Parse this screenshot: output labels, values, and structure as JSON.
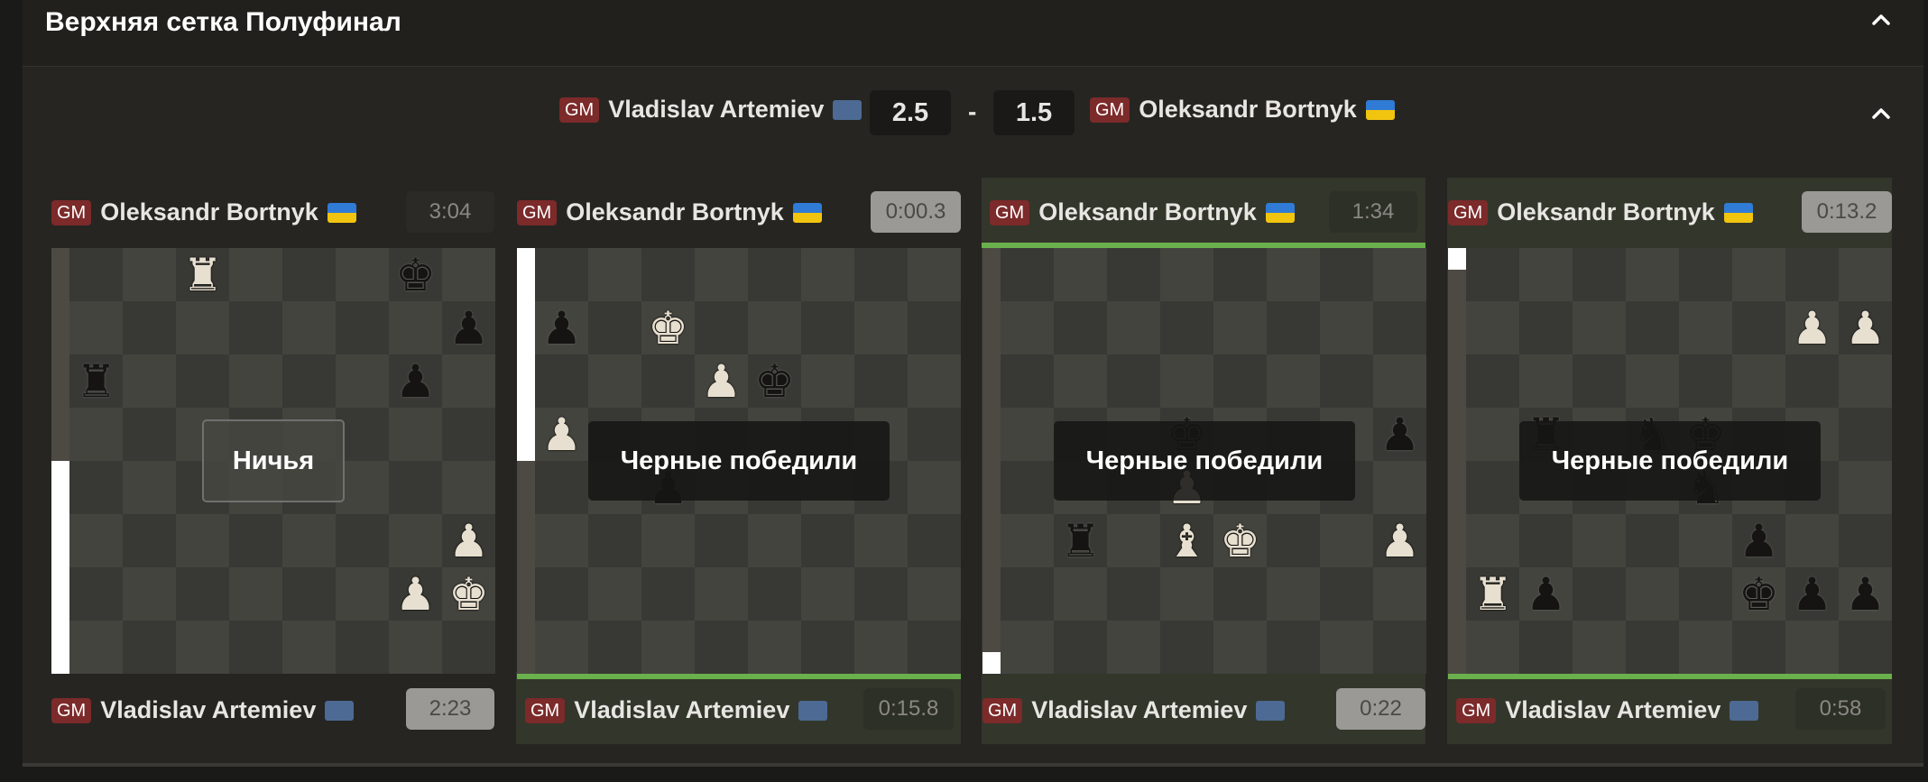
{
  "section": {
    "title": "Верхняя сетка Полуфинал"
  },
  "match": {
    "left_player": {
      "title": "GM",
      "name": "Vladislav Artemiev",
      "score": "2.5"
    },
    "separator": "-",
    "right_player": {
      "title": "GM",
      "name": "Oleksandr Bortnyk",
      "score": "1.5"
    }
  },
  "games": [
    {
      "top": {
        "title": "GM",
        "name": "Oleksandr Bortnyk",
        "clock": "3:04"
      },
      "bottom": {
        "title": "GM",
        "name": "Vladislav Artemiev",
        "clock": "2:23"
      },
      "result": "Ничья",
      "eval_white_fraction": 0.5,
      "pieces": [
        [
          "a8",
          ""
        ],
        [
          "c8",
          "wR"
        ],
        [
          "g8",
          "bK"
        ],
        [
          "h7",
          "bP"
        ],
        [
          "a6",
          "bR"
        ],
        [
          "g6",
          "bP"
        ],
        [
          "h3",
          "wP"
        ],
        [
          "g2",
          "wP"
        ],
        [
          "h2",
          "wK"
        ]
      ]
    },
    {
      "top": {
        "title": "GM",
        "name": "Oleksandr Bortnyk",
        "clock": "0:00.3"
      },
      "bottom": {
        "title": "GM",
        "name": "Vladislav Artemiev",
        "clock": "0:15.8"
      },
      "result": "Черные победили",
      "eval_white_fraction": 0.5,
      "pieces": [
        [
          "a7",
          "bP"
        ],
        [
          "c7",
          "wK"
        ],
        [
          "d6",
          "wP"
        ],
        [
          "e6",
          "bK"
        ],
        [
          "a5",
          "wP"
        ],
        [
          "c4",
          "bP"
        ]
      ]
    },
    {
      "top": {
        "title": "GM",
        "name": "Oleksandr Bortnyk",
        "clock": "1:34"
      },
      "bottom": {
        "title": "GM",
        "name": "Vladislav Artemiev",
        "clock": "0:22"
      },
      "result": "Черные победили",
      "eval_white_fraction": 0.05,
      "pieces": [
        [
          "d5",
          "bK"
        ],
        [
          "h5",
          "bP"
        ],
        [
          "d4",
          "wP"
        ],
        [
          "b3",
          "bR"
        ],
        [
          "d3",
          "wB"
        ],
        [
          "e3",
          "wK"
        ],
        [
          "h3",
          "wP"
        ]
      ]
    },
    {
      "top": {
        "title": "GM",
        "name": "Oleksandr Bortnyk",
        "clock": "0:13.2"
      },
      "bottom": {
        "title": "GM",
        "name": "Vladislav Artemiev",
        "clock": "0:58"
      },
      "result": "Черные победили",
      "eval_white_fraction": 0.05,
      "pieces": [
        [
          "g7",
          "wP"
        ],
        [
          "h7",
          "wP"
        ],
        [
          "b5",
          "bR"
        ],
        [
          "d5",
          "bN"
        ],
        [
          "e5",
          "bK"
        ],
        [
          "e4",
          "bN"
        ],
        [
          "f3",
          "bP"
        ],
        [
          "a2",
          "wR"
        ],
        [
          "b2",
          "bP"
        ],
        [
          "f2",
          "bK"
        ],
        [
          "g2",
          "bP"
        ],
        [
          "h2",
          "bP"
        ]
      ]
    }
  ],
  "icons": {
    "collapse": "chevron-up-icon",
    "flag_ukraine": "ukraine-flag-icon",
    "flag_neutral": "neutral-flag-icon"
  },
  "colors": {
    "gm_badge": "#7c2a2a",
    "winner_line": "#6ab04c",
    "board_light": "#44443f",
    "board_dark": "#383834"
  }
}
